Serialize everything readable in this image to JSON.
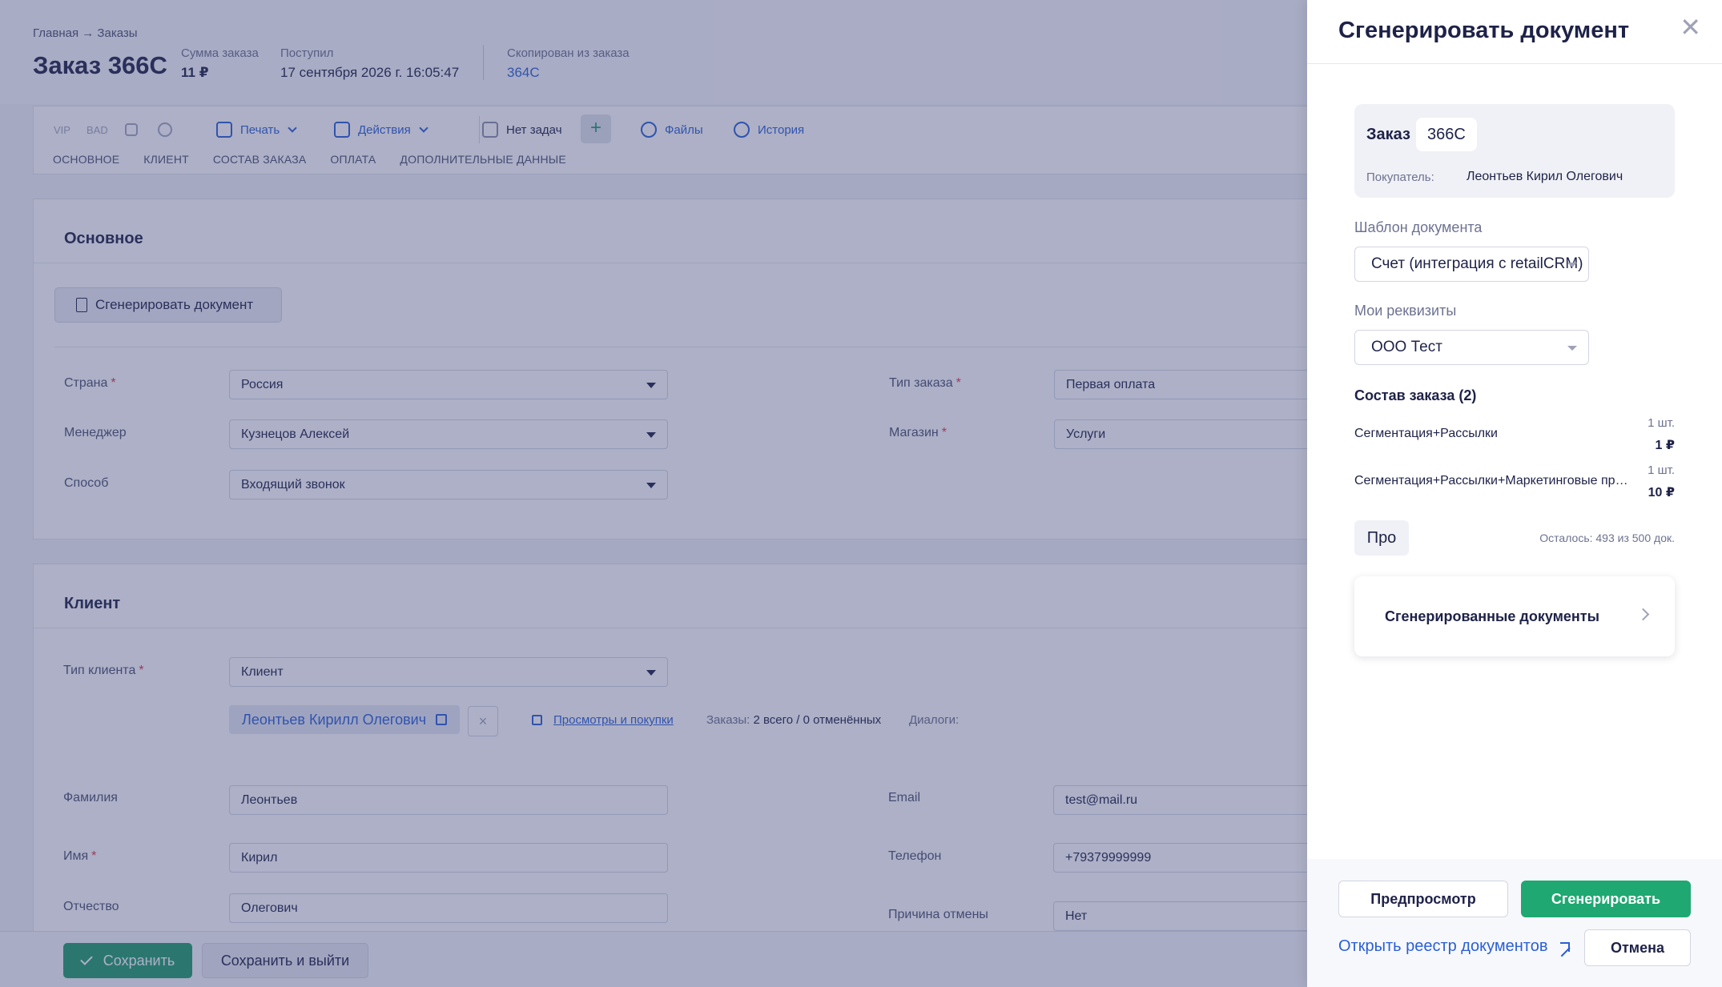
{
  "header": {
    "breadcrumb": "Главная → Заказы",
    "order_title": "Заказ 366C",
    "sum_label": "Сумма заказа",
    "sum_value": "11 ₽",
    "received_label": "Поступил",
    "received_value": "17 сентября 2026 г. 16:05:47",
    "copied_label": "Скопирован из заказа",
    "copied_value": "364C"
  },
  "toolbar": {
    "vip": "VIP",
    "bad": "BAD",
    "print": "Печать",
    "actions": "Действия",
    "tasks": "Нет задач",
    "add": "+",
    "files": "Файлы",
    "history": "История"
  },
  "tabs": [
    "ОСНОВНОЕ",
    "КЛИЕНТ",
    "СОСТАВ ЗАКАЗА",
    "ОПЛАТА",
    "ДОПОЛНИТЕЛЬНЫЕ ДАННЫЕ"
  ],
  "main_section": {
    "title": "Основное",
    "generate_button": "Сгенерировать документ",
    "country_label": "Страна",
    "country_value": "Россия",
    "manager_label": "Менеджер",
    "manager_value": "Кузнецов Алексей",
    "method_label": "Способ",
    "method_value": "Входящий звонок",
    "order_type_label": "Тип заказа",
    "order_type_value": "Первая оплата",
    "shop_label": "Магазин",
    "shop_value": "Услуги",
    "required_mark": "*"
  },
  "client_section": {
    "title": "Клиент",
    "client_type_label": "Тип клиента",
    "client_type_value": "Клиент",
    "client_name": "Леонтьев Кирилл Олегович",
    "remove": "×",
    "views_link": "Просмотры и покупки",
    "orders_label": "Заказы:",
    "orders_value": "2 всего / 0 отменённых",
    "dialogs_label": "Диалоги:",
    "last_name_label": "Фамилия",
    "last_name_value": "Леонтьев",
    "first_name_label": "Имя",
    "first_name_value": "Кирил",
    "patronymic_label": "Отчество",
    "patronymic_value": "Олегович",
    "email_label": "Email",
    "email_value": "test@mail.ru",
    "phone_label": "Телефон",
    "phone_value": "+79379999999",
    "cancel_reason_label": "Причина отмены",
    "cancel_reason_value": "Нет"
  },
  "footer": {
    "save": "Сохранить",
    "save_exit": "Сохранить и выйти"
  },
  "drawer": {
    "title": "Сгенерировать документ",
    "close": "✕",
    "order_label": "Заказ",
    "order_number": "366C",
    "buyer_label": "Покупатель:",
    "buyer_value": "Леонтьев Кирил Олегович",
    "template_label": "Шаблон документа",
    "template_value": "Счет (интеграция с retailCRM)",
    "requisites_label": "Мои реквизиты",
    "requisites_value": "ООО Тест",
    "composition_title": "Состав заказа (2)",
    "items": [
      {
        "name": "Сегментация+Рассылки",
        "qty": "1 шт.",
        "price": "1 ₽"
      },
      {
        "name": "Сегментация+Рассылки+Маркетинговые процессы",
        "qty": "1 шт.",
        "price": "10 ₽"
      }
    ],
    "plan_badge": "Про",
    "remaining": "Осталось: 493 из 500 док.",
    "generated_docs": "Сгенерированные документы",
    "preview_button": "Предпросмотр",
    "generate_button": "Сгенерировать",
    "registry_link": "Открыть реестр документов",
    "cancel_button": "Отмена"
  },
  "colors": {
    "accent_green": "#1fa872",
    "link_blue": "#2a5fd6",
    "overlay": "#3c4278"
  }
}
